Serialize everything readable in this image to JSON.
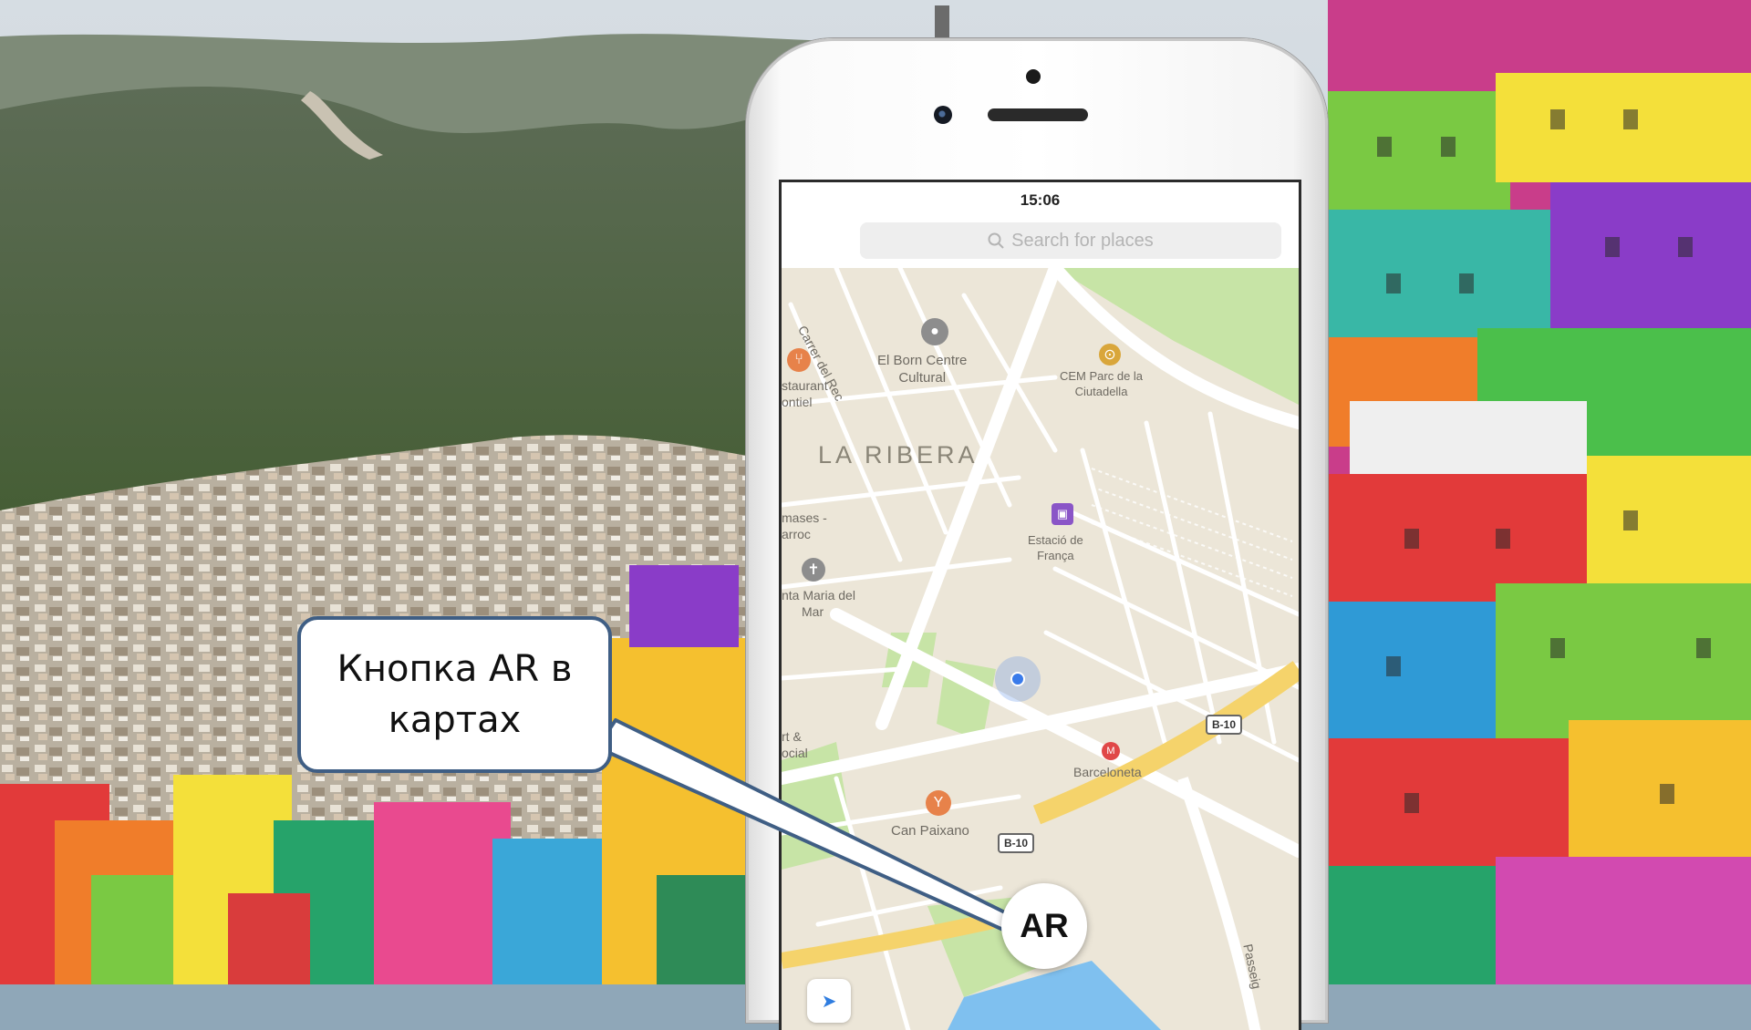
{
  "phone": {
    "status_time": "15:06",
    "search": {
      "placeholder": "Search for places"
    },
    "map": {
      "district": "LA RIBERA",
      "pois": [
        {
          "name": "El Born Centre Cultural",
          "lines": [
            "El Born Centre",
            "Cultural"
          ],
          "icon": "museum-icon"
        },
        {
          "name": "CEM Parc de la Ciutadella",
          "lines": [
            "CEM Parc de la",
            "Ciutadella"
          ],
          "icon": "sports-center-icon"
        },
        {
          "name": "Restaurant Montiel",
          "lines": [
            "staurant",
            "ontiel"
          ],
          "icon": "restaurant-icon"
        },
        {
          "name": "Tomases - Barroc",
          "lines": [
            "mases -",
            "arroc"
          ],
          "icon": "place-icon"
        },
        {
          "name": "Santa Maria del Mar",
          "lines": [
            "nta Maria del",
            "Mar"
          ],
          "icon": "church-icon"
        },
        {
          "name": "Estació de França",
          "lines": [
            "Estació de",
            "França"
          ],
          "icon": "train-station-icon"
        },
        {
          "name": "Art & Social",
          "lines": [
            "rt &",
            "ocial"
          ],
          "icon": "art-icon"
        },
        {
          "name": "Barceloneta",
          "lines": [
            "Barceloneta"
          ],
          "icon": "metro-icon"
        },
        {
          "name": "Can Paixano",
          "lines": [
            "Can Paixano"
          ],
          "icon": "bar-icon"
        }
      ],
      "streets": [
        "Carrer del Rec",
        "Passeig"
      ],
      "road_badges": [
        "B-10",
        "B-10"
      ]
    },
    "ar_button_label": "AR"
  },
  "callout": {
    "line1": "Кнопка AR в",
    "line2": "картах"
  },
  "colors": {
    "map_base": "#ece6d8",
    "park": "#c7e4a6",
    "road": "#ffffff",
    "highway": "#f5d36b",
    "water": "#7fc0ef",
    "user_location": "#3a7bea",
    "callout_border": "#3f5e84"
  }
}
